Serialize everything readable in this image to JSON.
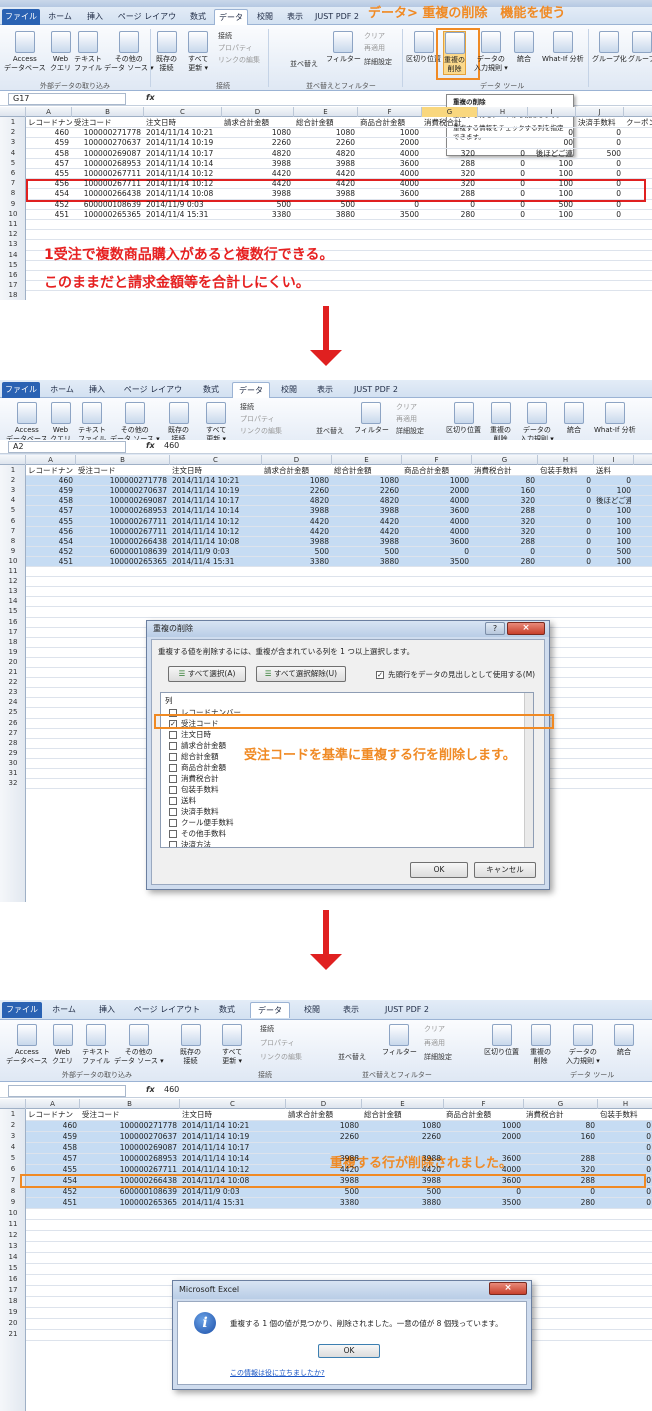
{
  "annotations": {
    "top_title": "データ> 重複の削除　機能を使う",
    "note_line1": "1受注で複数商品購入があると複数行できる。",
    "note_line2": "このままだと請求金額等を合計しにくい。",
    "dialog_note": "受注コードを基準に重複する行を削除します。",
    "result_note": "重複する行が削除されました。"
  },
  "ribbon": {
    "tabs": [
      "ファイル",
      "ホーム",
      "挿入",
      "ページ レイアウト",
      "数式",
      "データ",
      "校閲",
      "表示",
      "JUST PDF 2"
    ],
    "buttons": {
      "access": "Access\nデータベース",
      "web": "Web\nクエリ",
      "text": "テキスト\nファイル",
      "other": "その他の\nデータ ソース ▾",
      "existing": "既存の\n接続",
      "refresh": "すべて\n更新 ▾",
      "connections": "接続",
      "properties": "プロパティ",
      "edit_links": "リンクの編集",
      "sort_az": "並べ替え",
      "filter": "フィルター",
      "clear": "クリア",
      "reapply": "再適用",
      "advanced": "詳細設定",
      "text_to_cols": "区切り位置",
      "remove_dup": "重複の\n削除",
      "validation": "データの\n入力規則 ▾",
      "consolidate": "統合",
      "whatif": "What-If 分析",
      "group": "グループ化",
      "ungroup": "グループ"
    },
    "groups": {
      "external": "外部データの取り込み",
      "conn": "接続",
      "sortfilter": "並べ替えとフィルター",
      "datatools": "データ ツール"
    }
  },
  "sheet1": {
    "namebox": "G17",
    "formula": "",
    "columns": [
      "A",
      "B",
      "C",
      "D",
      "E",
      "F",
      "G",
      "H",
      "I",
      "J"
    ],
    "headers": [
      "レコードナン",
      "受注コード",
      "注文日時",
      "請求合計金額",
      "総合計金額",
      "商品合計金額",
      "消費税合計",
      "",
      "",
      "決済手数料",
      "クーポン"
    ],
    "rows": [
      [
        "460",
        "100000271778",
        "2014/11/14 10:21",
        "1080",
        "1080",
        "1000",
        "",
        "",
        "0",
        "0"
      ],
      [
        "459",
        "100000270637",
        "2014/11/14 10:19",
        "2260",
        "2260",
        "2000",
        "",
        "",
        "00",
        "0"
      ],
      [
        "458",
        "100000269087",
        "2014/11/14 10:17",
        "4820",
        "4820",
        "4000",
        "320",
        "0",
        "後ほどご連",
        "500"
      ],
      [
        "457",
        "100000268953",
        "2014/11/14 10:14",
        "3988",
        "3988",
        "3600",
        "288",
        "0",
        "100",
        "0"
      ],
      [
        "455",
        "100000267711",
        "2014/11/14 10:12",
        "4420",
        "4420",
        "4000",
        "320",
        "0",
        "100",
        "0"
      ],
      [
        "456",
        "100000267711",
        "2014/11/14 10:12",
        "4420",
        "4420",
        "4000",
        "320",
        "0",
        "100",
        "0"
      ],
      [
        "454",
        "100000266438",
        "2014/11/14 10:08",
        "3988",
        "3988",
        "3600",
        "288",
        "0",
        "100",
        "0"
      ],
      [
        "452",
        "600000108639",
        "2014/11/9 0:03",
        "500",
        "500",
        "0",
        "0",
        "0",
        "500",
        "0"
      ],
      [
        "451",
        "100000265365",
        "2014/11/4 15:31",
        "3380",
        "3880",
        "3500",
        "280",
        "0",
        "100",
        "0"
      ]
    ],
    "row_numbers": [
      "1",
      "2",
      "3",
      "4",
      "5",
      "6",
      "7",
      "8",
      "9",
      "10",
      "11",
      "12",
      "13",
      "14",
      "15"
    ]
  },
  "tooltip": {
    "title": "重複の削除",
    "line1": "重複する行をシートから削除します。",
    "line2": "重複する情報をチェックする列を指定",
    "line3": "できます。"
  },
  "sheet2": {
    "namebox": "A2",
    "formula": "460",
    "columns": [
      "A",
      "B",
      "C",
      "D",
      "E",
      "F",
      "G",
      "H",
      "I"
    ],
    "headers": [
      "レコードナン",
      "受注コード",
      "注文日時",
      "請求合計金額",
      "総合計金額",
      "商品合計金額",
      "消費税合計",
      "包装手数料",
      "送料"
    ],
    "rows": [
      [
        "460",
        "100000271778",
        "2014/11/14 10:21",
        "1080",
        "1080",
        "1000",
        "80",
        "0",
        "0"
      ],
      [
        "459",
        "100000270637",
        "2014/11/14 10:19",
        "2260",
        "2260",
        "2000",
        "160",
        "0",
        "100"
      ],
      [
        "458",
        "100000269087",
        "2014/11/14 10:17",
        "4820",
        "4820",
        "4000",
        "320",
        "0",
        "後ほどご連"
      ],
      [
        "457",
        "100000268953",
        "2014/11/14 10:14",
        "3988",
        "3988",
        "3600",
        "288",
        "0",
        "100"
      ],
      [
        "455",
        "100000267711",
        "2014/11/14 10:12",
        "4420",
        "4420",
        "4000",
        "320",
        "0",
        "100"
      ],
      [
        "456",
        "100000267711",
        "2014/11/14 10:12",
        "4420",
        "4420",
        "4000",
        "320",
        "0",
        "100"
      ],
      [
        "454",
        "100000266438",
        "2014/11/14 10:08",
        "3988",
        "3988",
        "3600",
        "288",
        "0",
        "100"
      ],
      [
        "452",
        "600000108639",
        "2014/11/9 0:03",
        "500",
        "500",
        "0",
        "0",
        "0",
        "500"
      ],
      [
        "451",
        "100000265365",
        "2014/11/4 15:31",
        "3380",
        "3880",
        "3500",
        "280",
        "0",
        "100"
      ]
    ]
  },
  "dialog": {
    "title": "重複の削除",
    "instruction": "重複する値を削除するには、重複が含まれている列を 1 つ以上選択します。",
    "select_all": "すべて選択(A)",
    "unselect_all": "すべて選択解除(U)",
    "header_row": "先頭行をデータの見出しとして使用する(M)",
    "list_header": "列",
    "items": [
      "レコードナンバー",
      "受注コード",
      "注文日時",
      "請求合計金額",
      "総合計金額",
      "商品合計金額",
      "消費税合計",
      "包装手数料",
      "送料",
      "決済手数料",
      "クール便手数料",
      "その他手数料",
      "決済方法"
    ],
    "checked_index": 1,
    "ok": "OK",
    "cancel": "キャンセル",
    "help": "?"
  },
  "sheet3": {
    "namebox": "",
    "formula": "460",
    "columns": [
      "A",
      "B",
      "C",
      "D",
      "E",
      "F",
      "G",
      "H"
    ],
    "headers": [
      "レコードナン",
      "受注コード",
      "注文日時",
      "請求合計金額",
      "総合計金額",
      "商品合計金額",
      "消費税合計",
      "包装手数料"
    ],
    "rows": [
      [
        "460",
        "100000271778",
        "2014/11/14 10:21",
        "1080",
        "1080",
        "1000",
        "80",
        "0"
      ],
      [
        "459",
        "100000270637",
        "2014/11/14 10:19",
        "2260",
        "2260",
        "2000",
        "160",
        "0"
      ],
      [
        "458",
        "100000269087",
        "2014/11/14 10:17",
        "",
        "",
        "",
        "",
        "0"
      ],
      [
        "457",
        "100000268953",
        "2014/11/14 10:14",
        "3988",
        "3988",
        "3600",
        "288",
        "0"
      ],
      [
        "455",
        "100000267711",
        "2014/11/14 10:12",
        "4420",
        "4420",
        "4000",
        "320",
        "0"
      ],
      [
        "454",
        "100000266438",
        "2014/11/14 10:08",
        "3988",
        "3988",
        "3600",
        "288",
        "0"
      ],
      [
        "452",
        "600000108639",
        "2014/11/9 0:03",
        "500",
        "500",
        "0",
        "0",
        "0"
      ],
      [
        "451",
        "100000265365",
        "2014/11/4 15:31",
        "3380",
        "3880",
        "3500",
        "280",
        "0"
      ]
    ]
  },
  "msgbox": {
    "title": "Microsoft Excel",
    "message": "重複する 1 個の値が見つかり、削除されました。一意の値が 8 個残っています。",
    "ok": "OK",
    "link": "この情報は役に立ちましたか?"
  }
}
